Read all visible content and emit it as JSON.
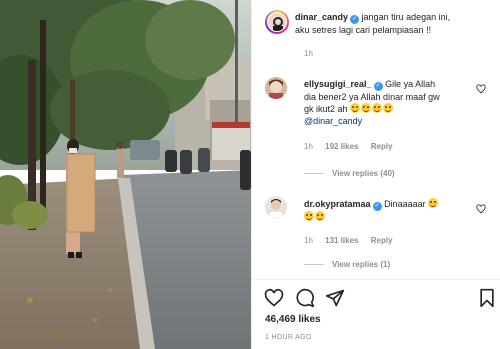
{
  "post": {
    "author": "dinar_candy",
    "caption": "jangan tiru adegan ini, aku setres lagi cari pelampiasan !!",
    "caption_line1": "jangan tiru adegan ini,",
    "caption_line2": "aku setres lagi cari pelampiasan !!",
    "age": "1h",
    "likes": "46,469 likes",
    "posted": "1 HOUR AGO"
  },
  "comments": [
    {
      "author": "ellysugigi_real_",
      "text_line1": "Gile ya Allah",
      "text_line2": "dia bener2 ya Allah dinar maaf gw",
      "text_line3": "gk ikut2 ah",
      "mention": "@dinar_candy",
      "age": "1h",
      "likes": "192 likes",
      "reply": "Reply",
      "view_replies": "View replies (40)",
      "emoji_count": 4
    },
    {
      "author": "dr.okypratamaa",
      "text_line1": "Dinaaaaar",
      "age": "1h",
      "likes": "131 likes",
      "reply": "Reply",
      "view_replies": "View replies (1)",
      "emoji_count": 2
    }
  ],
  "icons": {
    "like": "heart-icon",
    "comment": "comment-icon",
    "share": "paper-plane-icon",
    "save": "bookmark-icon",
    "verified": "verified-badge-icon"
  },
  "colors": {
    "text": "#262626",
    "muted": "#8e8e8e",
    "verified": "#3897f0",
    "mention": "#00376b",
    "divider": "#efefef"
  }
}
